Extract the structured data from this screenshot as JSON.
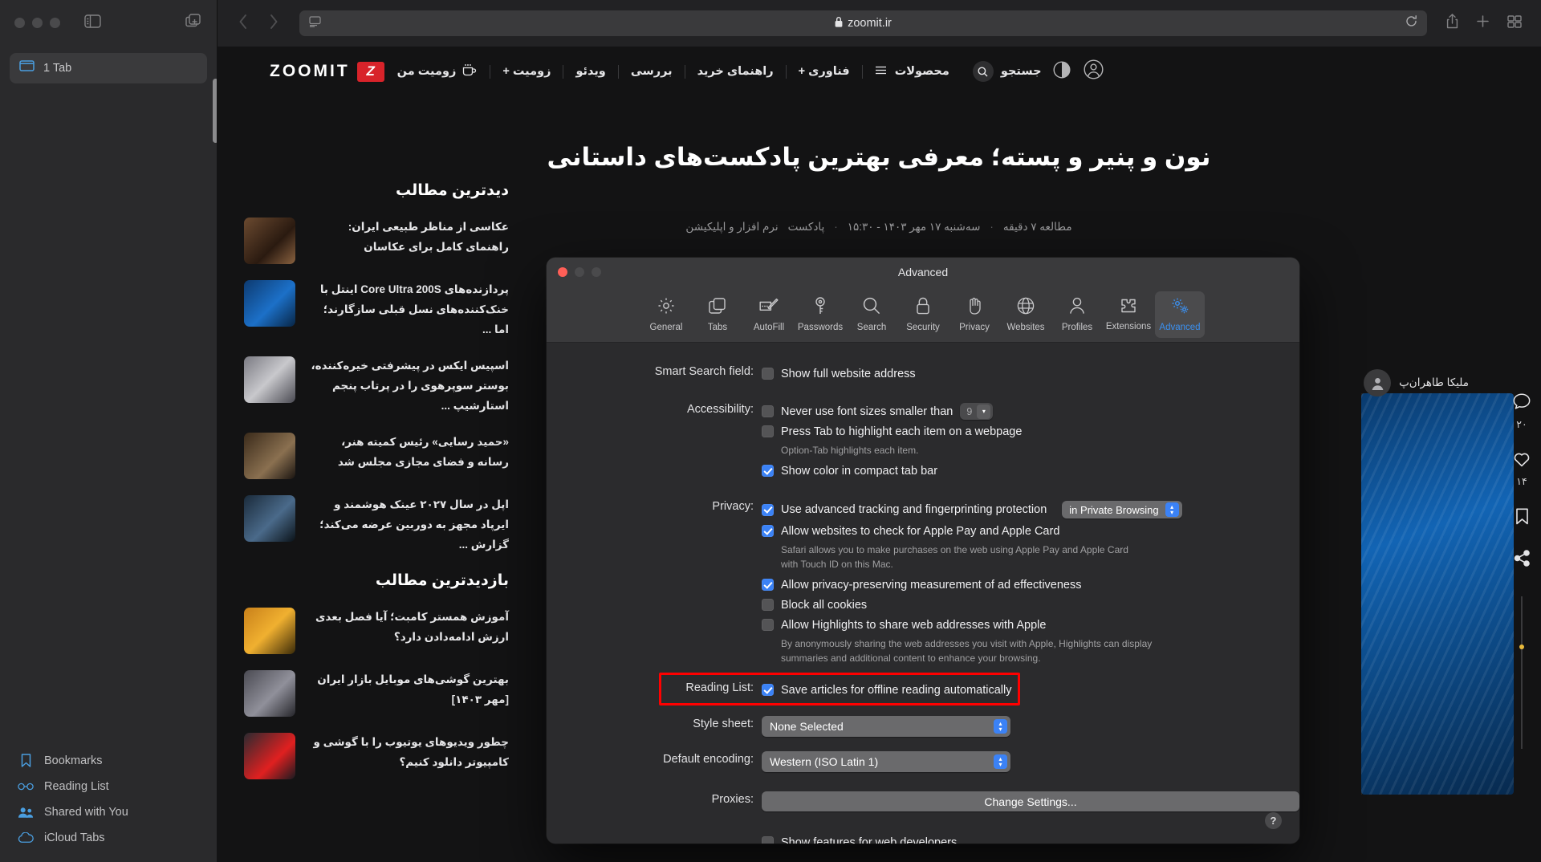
{
  "browser": {
    "url": "zoomit.ir",
    "lock_icon": "lock-icon",
    "sidebar": {
      "tab_count_label": "1 Tab",
      "items": [
        {
          "label": "Bookmarks",
          "icon": "bookmark-icon"
        },
        {
          "label": "Reading List",
          "icon": "glasses-icon"
        },
        {
          "label": "Shared with You",
          "icon": "people-icon"
        },
        {
          "label": "iCloud Tabs",
          "icon": "cloud-icon"
        }
      ]
    }
  },
  "site": {
    "logo_mark": "Z",
    "logo_text": "ZOOMIT",
    "my_zoomit_label": "زومیت من",
    "my_zoomit_icon": "cup-icon",
    "nav_items": [
      {
        "label": "محصولات",
        "icon": "hamburger-icon"
      },
      {
        "label": "فناوری +"
      },
      {
        "label": "راهنمای خرید"
      },
      {
        "label": "بررسی"
      },
      {
        "label": "ویدئو"
      },
      {
        "label": "زومیت +"
      }
    ],
    "search_label": "جستجو",
    "article": {
      "title": "نون و پنیر و پسته؛ معرفی بهترین پادکست‌های داستانی",
      "meta": [
        "نرم افزار و اپلیکیشن",
        "پادکست",
        "سه‌شنبه ۱۷ مهر ۱۴۰۳ - ۱۵:۳۰",
        "مطالعه ۷ دقیقه"
      ],
      "author": "ملیکا طاهران‌پ"
    },
    "rail": [
      {
        "icon": "comment-icon",
        "count": "۲۰"
      },
      {
        "icon": "heart-icon",
        "count": "۱۴"
      },
      {
        "icon": "bookmark-icon",
        "count": ""
      },
      {
        "icon": "share-icon",
        "count": ""
      }
    ],
    "lists": [
      {
        "heading": "دیدترین مطالب",
        "items": [
          {
            "text": "عکاسی از مناظر طبیعی ایران: راهنمای کامل برای عکاسان"
          },
          {
            "text": "پردازنده‌های Core Ultra 200S اینتل با خنک‌کننده‌های نسل قبلی سازگارند؛ اما ..."
          },
          {
            "text": "اسپیس ایکس در پیشرفتی خیره‌کننده، بوستر سوپرهوی را در پرتاب پنجم استارشیپ ..."
          },
          {
            "text": "«حمید رسایی» رئیس کمیته هنر، رسانه و فضای مجازی مجلس شد"
          },
          {
            "text": "اپل در سال ۲۰۲۷ عینک هوشمند و ایرپاد مجهز به دوربین عرضه می‌کند؛ گزارش ..."
          }
        ]
      },
      {
        "heading": "بازدیدترین مطالب",
        "items": [
          {
            "text": "آموزش همستر کامبت؛ آیا فصل بعدی ارزش ادامه‌دادن دارد؟"
          },
          {
            "text": "بهترین گوشی‌های موبایل بازار ایران [مهر ۱۴۰۳]"
          },
          {
            "text": "چطور ویدیوهای یوتیوب را با گوشی و کامپیوتر دانلود کنیم؟"
          }
        ]
      }
    ]
  },
  "dialog": {
    "title": "Advanced",
    "toolbar": [
      {
        "label": "General",
        "icon": "gear-icon"
      },
      {
        "label": "Tabs",
        "icon": "tabs-icon"
      },
      {
        "label": "AutoFill",
        "icon": "autofill-icon"
      },
      {
        "label": "Passwords",
        "icon": "key-icon"
      },
      {
        "label": "Search",
        "icon": "search-icon"
      },
      {
        "label": "Security",
        "icon": "lock-icon"
      },
      {
        "label": "Privacy",
        "icon": "hand-icon"
      },
      {
        "label": "Websites",
        "icon": "globe-icon"
      },
      {
        "label": "Profiles",
        "icon": "person-icon"
      },
      {
        "label": "Extensions",
        "icon": "puzzle-icon"
      },
      {
        "label": "Advanced",
        "icon": "advanced-gears-icon"
      }
    ],
    "selected_tab": "Advanced",
    "accent_color": "#3b90f0",
    "highlight_color": "#ff0000",
    "rows": {
      "smart_search": {
        "label": "Smart Search field:",
        "checkbox_label": "Show full website address",
        "checked": false
      },
      "accessibility": {
        "label": "Accessibility:",
        "font_size_label": "Never use font sizes smaller than",
        "font_size_checked": false,
        "font_size_value": "9",
        "press_tab_label": "Press Tab to highlight each item on a webpage",
        "press_tab_checked": false,
        "press_tab_note": "Option-Tab highlights each item.",
        "compact_tab_label": "Show color in compact tab bar",
        "compact_tab_checked": true
      },
      "privacy": {
        "label": "Privacy:",
        "tracking_label": "Use advanced tracking and fingerprinting protection",
        "tracking_checked": true,
        "tracking_scope": "in Private Browsing",
        "apple_pay_label": "Allow websites to check for Apple Pay and Apple Card",
        "apple_pay_checked": true,
        "apple_pay_note": "Safari allows you to make purchases on the web using Apple Pay and Apple Card with Touch ID on this Mac.",
        "ad_measurement_label": "Allow privacy-preserving measurement of ad effectiveness",
        "ad_measurement_checked": true,
        "block_cookies_label": "Block all cookies",
        "block_cookies_checked": false,
        "highlights_label": "Allow Highlights to share web addresses with Apple",
        "highlights_checked": false,
        "highlights_note": "By anonymously sharing the web addresses you visit with Apple, Highlights can display summaries and additional content to enhance your browsing."
      },
      "reading_list": {
        "label": "Reading List:",
        "checkbox_label": "Save articles for offline reading automatically",
        "checked": true,
        "highlighted": true
      },
      "style_sheet": {
        "label": "Style sheet:",
        "value": "None Selected"
      },
      "default_encoding": {
        "label": "Default encoding:",
        "value": "Western (ISO Latin 1)"
      },
      "proxies": {
        "label": "Proxies:",
        "button_label": "Change Settings..."
      },
      "web_developers": {
        "checkbox_label": "Show features for web developers",
        "checked": false
      }
    },
    "help_label": "?"
  }
}
